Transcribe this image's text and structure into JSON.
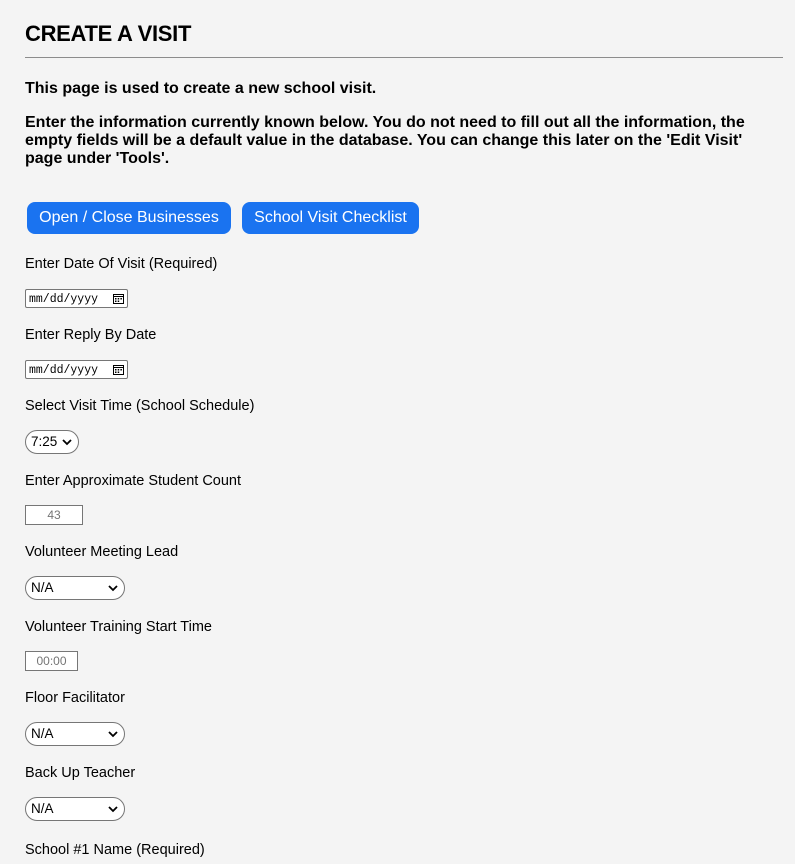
{
  "page": {
    "title": "CREATE A VISIT",
    "intro_1": "This page is used to create a new school visit.",
    "intro_2": "Enter the information currently known below. You do not need to fill out all the information, the empty fields will be a default value in the database. You can change this later on the 'Edit Visit' page under 'Tools'."
  },
  "buttons": {
    "open_close": "Open / Close Businesses",
    "checklist": "School Visit Checklist",
    "color": "#1a73f0"
  },
  "fields": {
    "visit_date": {
      "label": "Enter Date Of Visit (Required)",
      "placeholder": "mm/dd/yyyy"
    },
    "reply_by": {
      "label": "Enter Reply By Date",
      "placeholder": "mm/dd/yyyy"
    },
    "visit_time": {
      "label": "Select Visit Time (School Schedule)",
      "value": "7:25"
    },
    "student_count": {
      "label": "Enter Approximate Student Count",
      "placeholder": "43"
    },
    "meeting_lead": {
      "label": "Volunteer Meeting Lead",
      "value": "N/A"
    },
    "training_start": {
      "label": "Volunteer Training Start Time",
      "placeholder": "00:00"
    },
    "floor_facilitator": {
      "label": "Floor Facilitator",
      "value": "N/A"
    },
    "backup_teacher": {
      "label": "Back Up Teacher",
      "value": "N/A"
    },
    "school1_name": {
      "label": "School #1 Name (Required)"
    }
  }
}
